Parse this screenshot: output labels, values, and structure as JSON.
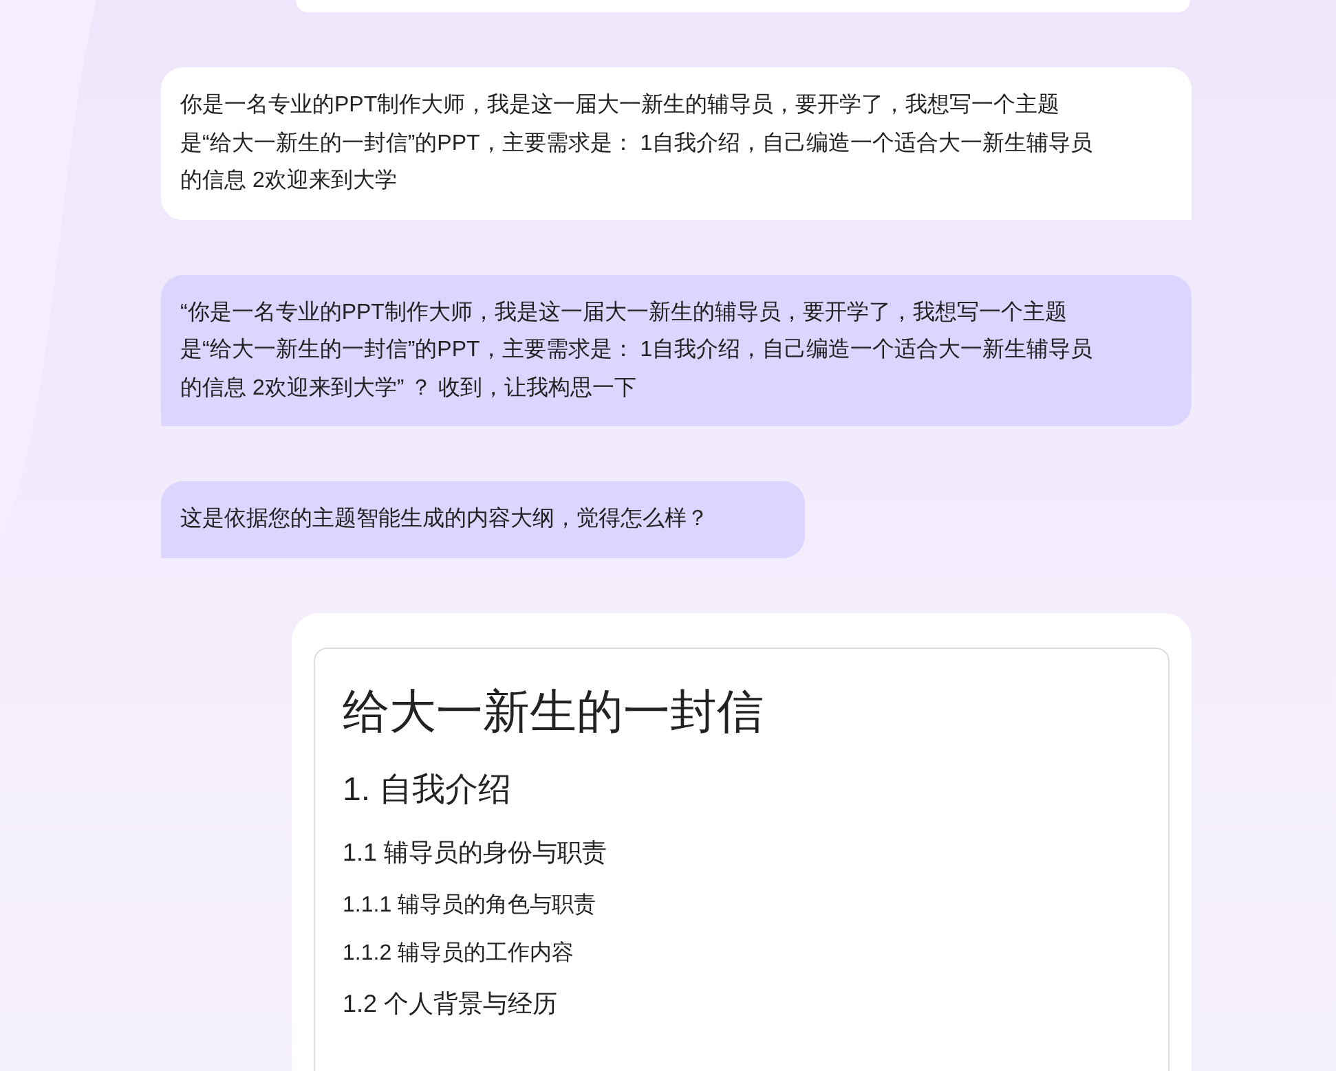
{
  "messages": [
    {
      "kind": "prompt",
      "text": "你是一名专业的PPT制作大师，我是这一届大一新生的辅导员，要开学了，我想写一个主题是“给大一新生的一封信”的PPT，主要需求是： 1自我介绍，自己编造一个适合大一新生辅导员的信息 2欢迎来到大学"
    },
    {
      "kind": "reply",
      "text": "“你是一名专业的PPT制作大师，我是这一届大一新生的辅导员，要开学了，我想写一个主题是“给大一新生的一封信”的PPT，主要需求是： 1自我介绍，自己编造一个适合大一新生辅导员的信息 2欢迎来到大学” ？ 收到，让我构思一下"
    },
    {
      "kind": "reply",
      "text": "这是依据您的主题智能生成的内容大纲，觉得怎么样？"
    }
  ],
  "outline": {
    "title": "给大一新生的一封信",
    "sections": [
      {
        "text": "1. 自我介绍",
        "children": [
          {
            "text": "1.1 辅导员的身份与职责",
            "children": [
              {
                "text": "1.1.1 辅导员的角色与职责"
              },
              {
                "text": "1.1.2 辅导员的工作内容"
              }
            ]
          },
          {
            "text": "1.2 个人背景与经历"
          }
        ]
      }
    ]
  }
}
